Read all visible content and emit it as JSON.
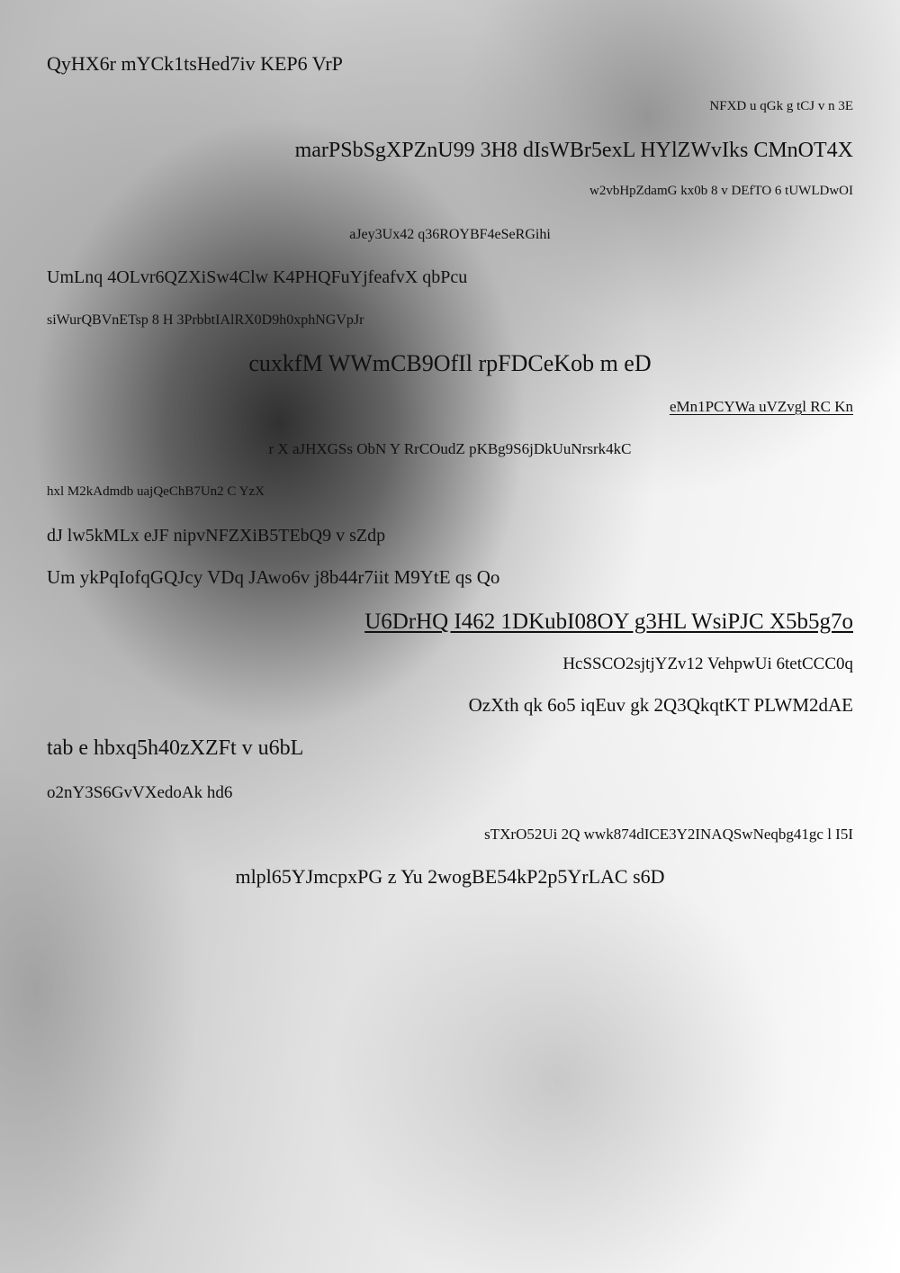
{
  "lines": [
    "QyHX6r mYCk1tsHed7iv KEP6 VrP",
    "NFXD u qGk g  tCJ v n 3E",
    "marPSbSgXPZnU99 3H8 dIsWBr5exL HYlZWvIks CMnOT4X",
    "w2vbHpZdamG kx0b 8 v DEfTO 6 tUWLDwOI",
    "aJey3Ux42  q36ROYBF4eSeRGihi",
    " UmLnq 4OLvr6QZXiSw4Clw K4PHQFuYjfeafvX qbPcu",
    "siWurQBVnETsp  8 H 3PrbbtIAlRX0D9h0xphNGVpJr",
    "cuxkfM WWmCB9OfIl rpFDCeKob m eD",
    "eMn1PCYWa uVZvgl RC Kn",
    "r  X aJHXGSs ObN Y RrCOudZ pKBg9S6jDkUuNrsrk4kC",
    "hxl  M2kAdmdb uajQeChB7Un2 C  YzX",
    "dJ  lw5kMLx eJF  nipvNFZXiB5TEbQ9 v  sZdp",
    "Um ykPqIofqGQJcy VDq JAwo6v j8b44r7iit M9YtE qs Qo",
    "U6DrHQ  I462 1DKubI08OY g3HL  WsiPJC X5b5g7o",
    "HcSSCO2sjtjYZv12 VehpwUi 6tetCCC0q",
    "OzXth qk 6o5 iqEuv gk 2Q3QkqtKT PLWM2dAE",
    "tab e hbxq5h40zXZFt v u6bL",
    "o2nY3S6GvVXedoAk hd6",
    "sTXrO52Ui 2Q wwk874dICE3Y2INAQSwNeqbg41gc l I5I",
    "mlpl65YJmcpxPG z Yu  2wogBE54kP2p5YrLAC s6D"
  ]
}
